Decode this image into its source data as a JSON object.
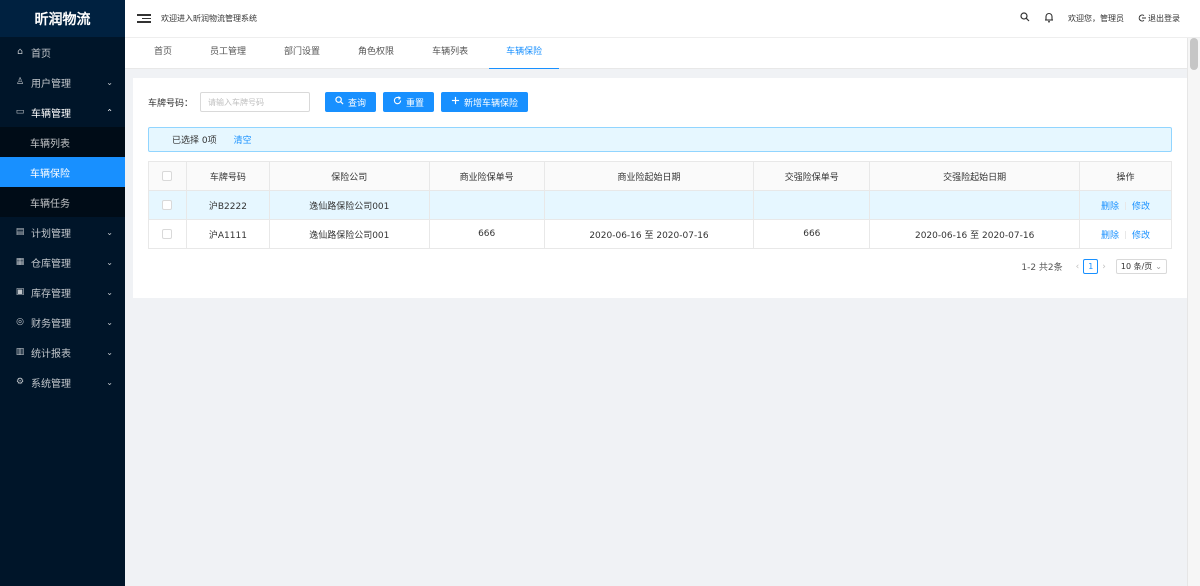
{
  "sidebar": {
    "logo": "昕润物流",
    "items": [
      {
        "label": "首页",
        "icon": "home-icon",
        "glyph": "⌂",
        "arrow": ""
      },
      {
        "label": "用户管理",
        "icon": "user-icon",
        "glyph": "♙",
        "arrow": "⌄"
      },
      {
        "label": "车辆管理",
        "icon": "car-icon",
        "glyph": "▭",
        "arrow": "⌃"
      },
      {
        "label": "计划管理",
        "icon": "plan-icon",
        "glyph": "▤",
        "arrow": "⌄"
      },
      {
        "label": "仓库管理",
        "icon": "warehouse-icon",
        "glyph": "▦",
        "arrow": "⌄"
      },
      {
        "label": "库存管理",
        "icon": "inventory-icon",
        "glyph": "▣",
        "arrow": "⌄"
      },
      {
        "label": "财务管理",
        "icon": "finance-icon",
        "glyph": "◎",
        "arrow": "⌄"
      },
      {
        "label": "统计报表",
        "icon": "chart-icon",
        "glyph": "▥",
        "arrow": "⌄"
      },
      {
        "label": "系统管理",
        "icon": "settings-icon",
        "glyph": "⚙",
        "arrow": "⌄"
      }
    ],
    "subitems": [
      "车辆列表",
      "车辆保险",
      "车辆任务"
    ],
    "active_subitem": "车辆保险"
  },
  "header": {
    "welcome": "欢迎进入昕润物流管理系统",
    "greeting": "欢迎您，管理员",
    "logout": "退出登录"
  },
  "tabs": [
    "首页",
    "员工管理",
    "部门设置",
    "角色权限",
    "车辆列表",
    "车辆保险"
  ],
  "active_tab": "车辆保险",
  "search": {
    "label": "车牌号码：",
    "placeholder": "请输入车牌号码",
    "value": "",
    "query_button": "查询",
    "reset_button": "重置",
    "add_button": "新增车辆保险"
  },
  "alert": {
    "selected": "已选择 0项",
    "clear": "清空"
  },
  "table": {
    "columns": [
      "车牌号码",
      "保险公司",
      "商业险保单号",
      "商业险起始日期",
      "交强险保单号",
      "交强险起始日期",
      "操作"
    ],
    "rows": [
      {
        "plate": "沪B2222",
        "company": "逸仙路保险公司001",
        "commercial_no": "",
        "commercial_date": "",
        "compulsory_no": "",
        "compulsory_date": "",
        "highlight": true
      },
      {
        "plate": "沪A1111",
        "company": "逸仙路保险公司001",
        "commercial_no": "666",
        "commercial_date": "2020-06-16 至 2020-07-16",
        "compulsory_no": "666",
        "compulsory_date": "2020-06-16 至 2020-07-16",
        "highlight": false
      }
    ],
    "action_delete": "删除",
    "action_edit": "修改"
  },
  "pagination": {
    "total_text": "1-2 共2条",
    "current_page": "1",
    "page_size": "10 条/页"
  },
  "colors": {
    "primary": "#1890ff",
    "sidebar_bg": "#001529",
    "page_bg": "#f0f2f5"
  }
}
